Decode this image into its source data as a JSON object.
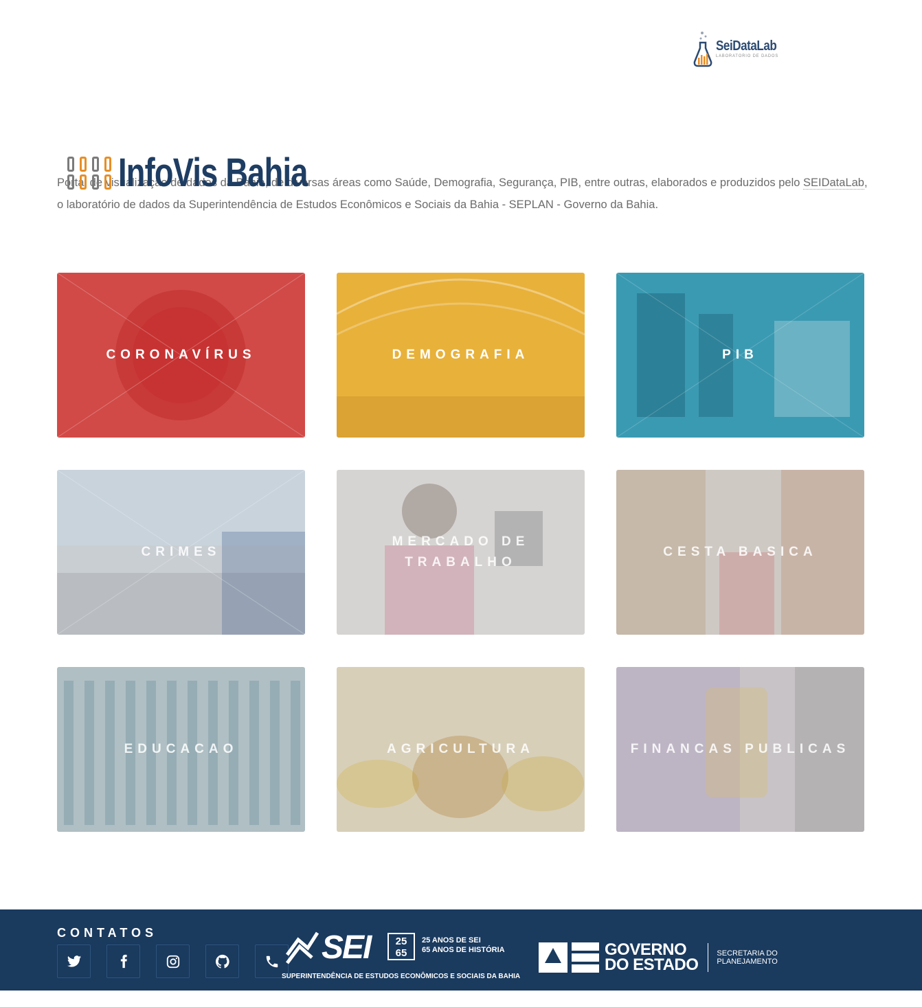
{
  "brand": {
    "name": "SeiDataLab",
    "subtitle": "LABORATÓRIO DE DADOS"
  },
  "header": {
    "title": "InfoVis Bahia"
  },
  "intro": {
    "part1": "Portal de visualização de dados da Bahia, de diversas áreas como Saúde, Demografia, Segurança, PIB, entre outras, elaborados e produzidos pelo ",
    "link": "SEIDataLab",
    "part2": ", o laboratório de dados da Superintendência de Estudos Econômicos e Sociais da Bahia - SEPLAN - Governo da Bahia."
  },
  "cards": [
    {
      "label": "CORONAVÍRUS",
      "color": "#d14a47"
    },
    {
      "label": "DEMOGRAFIA",
      "color": "#e8b13a"
    },
    {
      "label": "PIB",
      "color": "#3a9ab2"
    },
    {
      "label": "CRIMES",
      "color": "#c9ced3"
    },
    {
      "label": "MERCADO DE TRABALHO",
      "color": "#d6d4d2"
    },
    {
      "label": "CESTA BASICA",
      "color": "#cfc9c4"
    },
    {
      "label": "EDUCACAO",
      "color": "#b9c7c9"
    },
    {
      "label": "AGRICULTURA",
      "color": "#d8cfb9"
    },
    {
      "label": "FINANCAS PUBLICAS",
      "color": "#c7c3c6"
    }
  ],
  "footer": {
    "contacts_title": "CONTATOS",
    "socials": [
      "twitter-icon",
      "facebook-icon",
      "instagram-icon",
      "github-icon",
      "phone-icon"
    ],
    "sei": {
      "word": "SEI",
      "badge_top": "25",
      "badge_bottom": "65",
      "anos_line1": "25 ANOS DE SEI",
      "anos_line2": "65 ANOS DE HISTÓRIA",
      "full_name": "SUPERINTENDÊNCIA DE ESTUDOS ECONÔMICOS E SOCIAIS DA BAHIA"
    },
    "gov": {
      "line1": "GOVERNO",
      "line2": "DO ESTADO",
      "sec_line1": "SECRETARIA DO",
      "sec_line2": "PLANEJAMENTO"
    },
    "background": "#1a3a5e"
  }
}
